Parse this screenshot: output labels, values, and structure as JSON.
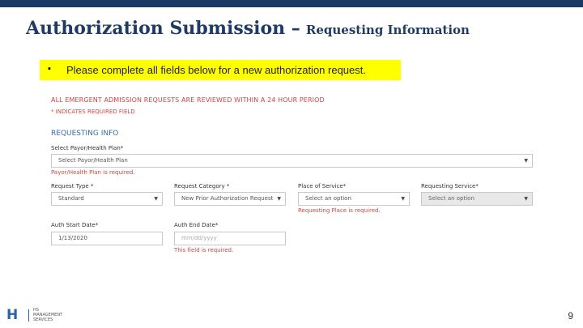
{
  "slide": {
    "title_main": "Authorization Submission –",
    "title_sub": "Requesting Information",
    "bullet_char": "▪",
    "bullet_text": "Please complete all fields below for a new authorization request.",
    "page_number": "9"
  },
  "form": {
    "notice": "ALL EMERGENT ADMISSION REQUESTS ARE REVIEWED WITHIN A 24 HOUR PERIOD",
    "required_note": "* INDICATES REQUIRED FIELD",
    "section_title": "REQUESTING INFO",
    "payor": {
      "label": "Select Payor/Health Plan*",
      "value": "Select Payor/Health Plan",
      "error": "Payor/Health Plan is required."
    },
    "request_type": {
      "label": "Request Type *",
      "value": "Standard"
    },
    "request_category": {
      "label": "Request Category *",
      "value": "New Prior Authorization Request"
    },
    "place_of_service": {
      "label": "Place of Service*",
      "value": "Select an option",
      "error": "Requesting Place is required."
    },
    "requesting_service": {
      "label": "Requesting Service*",
      "value": "Select an option"
    },
    "auth_start": {
      "label": "Auth Start Date*",
      "value": "1/13/2020"
    },
    "auth_end": {
      "label": "Auth End Date*",
      "placeholder": "mm/dd/yyyy",
      "error": "This field is required."
    },
    "dropdown_caret": "▼"
  },
  "logo": {
    "mark": "H",
    "line1": "HS",
    "line2": "MANAGEMENT",
    "line3": "SERVICES"
  },
  "colors": {
    "title": "#1f3b64",
    "top_bar": "#1a3a66",
    "highlight": "#ffff00",
    "error_red": "#d04545",
    "section_blue": "#3d6aa8"
  }
}
